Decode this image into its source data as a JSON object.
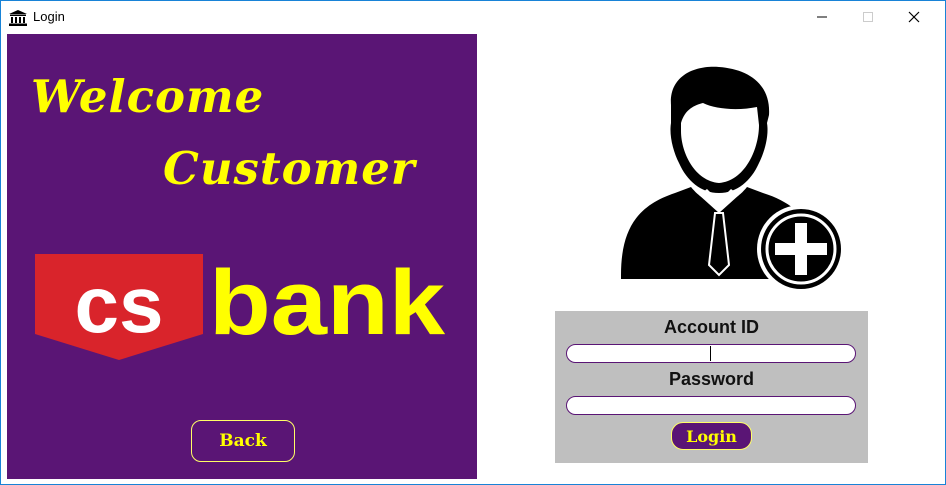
{
  "window": {
    "title": "Login",
    "icons": {
      "app": "bank-icon",
      "minimize": "minimize-icon",
      "maximize": "maximize-icon",
      "close": "close-icon"
    }
  },
  "left_panel": {
    "background": "#5a1575",
    "welcome_line1": "Welcome",
    "welcome_line2": "Customer",
    "logo": {
      "letters": "cs",
      "word": "bank",
      "shield_color": "#d9242b",
      "word_color": "#ffff00"
    },
    "back_label": "Back"
  },
  "right_panel": {
    "avatar_icon": "add-user-icon",
    "account_label": "Account ID",
    "account_value": "",
    "password_label": "Password",
    "password_value": "",
    "login_label": "Login"
  },
  "colors": {
    "accent": "#5a1575",
    "text_highlight": "#ffff00",
    "form_bg": "#bfbfbf"
  }
}
